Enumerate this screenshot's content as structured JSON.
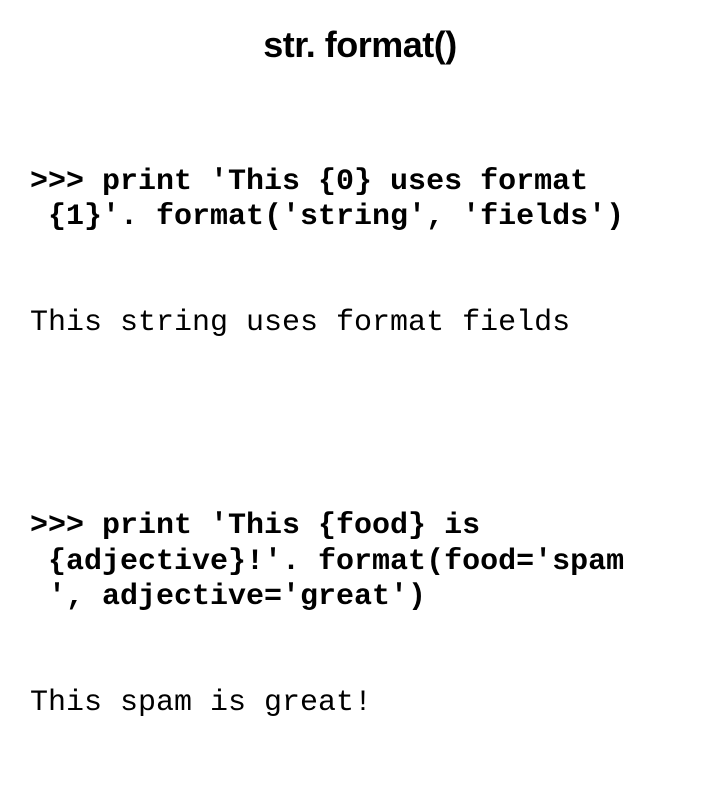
{
  "title": "str. format()",
  "examples": [
    {
      "input": ">>> print 'This {0} uses format\n {1}'. format('string', 'fields')",
      "output": "This string uses format fields"
    },
    {
      "input": ">>> print 'This {food} is\n {adjective}!'. format(food='spam\n ', adjective='great')",
      "output": "This spam is great!"
    }
  ]
}
